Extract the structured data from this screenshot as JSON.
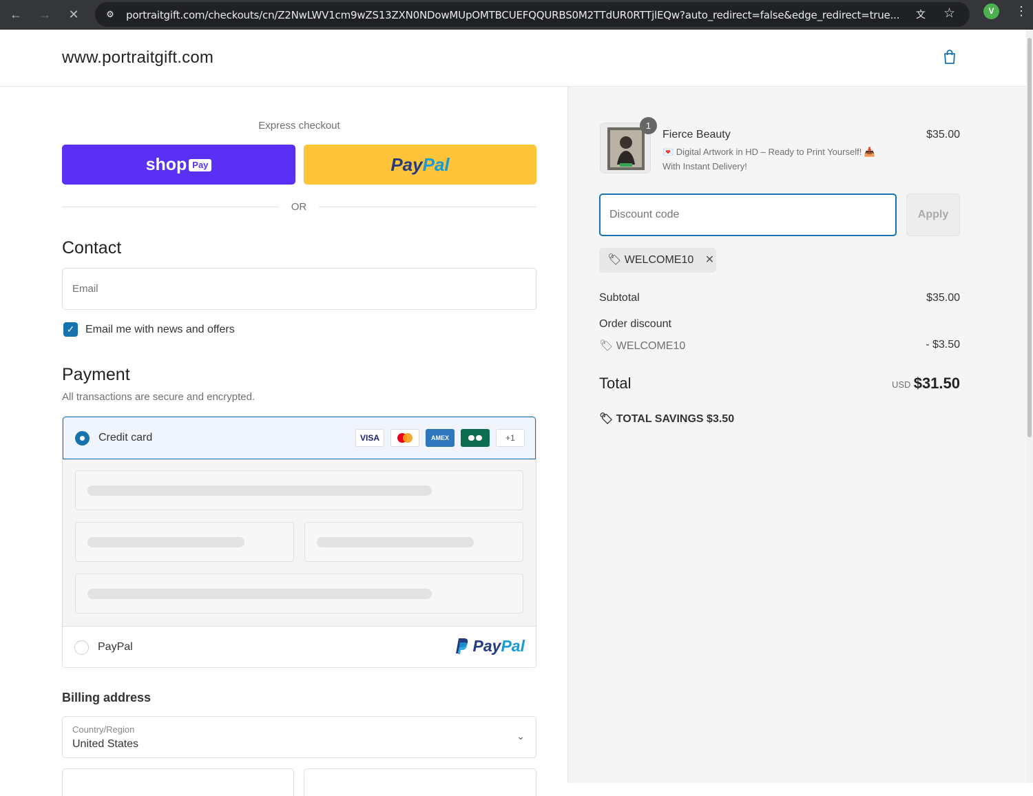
{
  "browser": {
    "url": "portraitgift.com/checkouts/cn/Z2NwLWV1cm9wZS13ZXN0NDowMUpOMTBCUEFQQURBS0M2TTdUR0RTTjlEQw?auto_redirect=false&edge_redirect=true...",
    "profile_initial": "V"
  },
  "header": {
    "shop_name": "www.portraitgift.com"
  },
  "express": {
    "title": "Express checkout",
    "shoppay_label": "shop",
    "shoppay_chip": "Pay",
    "paypal_part1": "Pay",
    "paypal_part2": "Pal",
    "or": "OR"
  },
  "contact": {
    "heading": "Contact",
    "email_placeholder": "Email",
    "newsletter_label": "Email me with news and offers"
  },
  "payment": {
    "heading": "Payment",
    "subtitle": "All transactions are secure and encrypted.",
    "credit_card_label": "Credit card",
    "card_logos": [
      "VISA",
      "",
      "AMEX",
      "",
      "+1"
    ],
    "paypal_label": "PayPal",
    "paypal_logo_part1": "Pay",
    "paypal_logo_part2": "Pal"
  },
  "billing": {
    "heading": "Billing address",
    "country_label": "Country/Region",
    "country_value": "United States"
  },
  "summary": {
    "product_name": "Fierce Beauty",
    "product_desc_line1": "💌 Digital Artwork in HD – Ready to Print Yourself! 📥",
    "product_desc_line2": "With Instant Delivery!",
    "product_price": "$35.00",
    "quantity": "1",
    "discount_placeholder": "Discount code",
    "apply_label": "Apply",
    "applied_code": "WELCOME10",
    "subtotal_label": "Subtotal",
    "subtotal_value": "$35.00",
    "order_discount_label": "Order discount",
    "discount_code": "WELCOME10",
    "discount_value": "- $3.50",
    "total_label": "Total",
    "currency": "USD",
    "total_value": "$31.50",
    "savings_label": "TOTAL SAVINGS",
    "savings_value": "$3.50"
  },
  "colors": {
    "accent": "#1773b0",
    "shoppay": "#5a31f4",
    "paypal": "#ffc439"
  }
}
